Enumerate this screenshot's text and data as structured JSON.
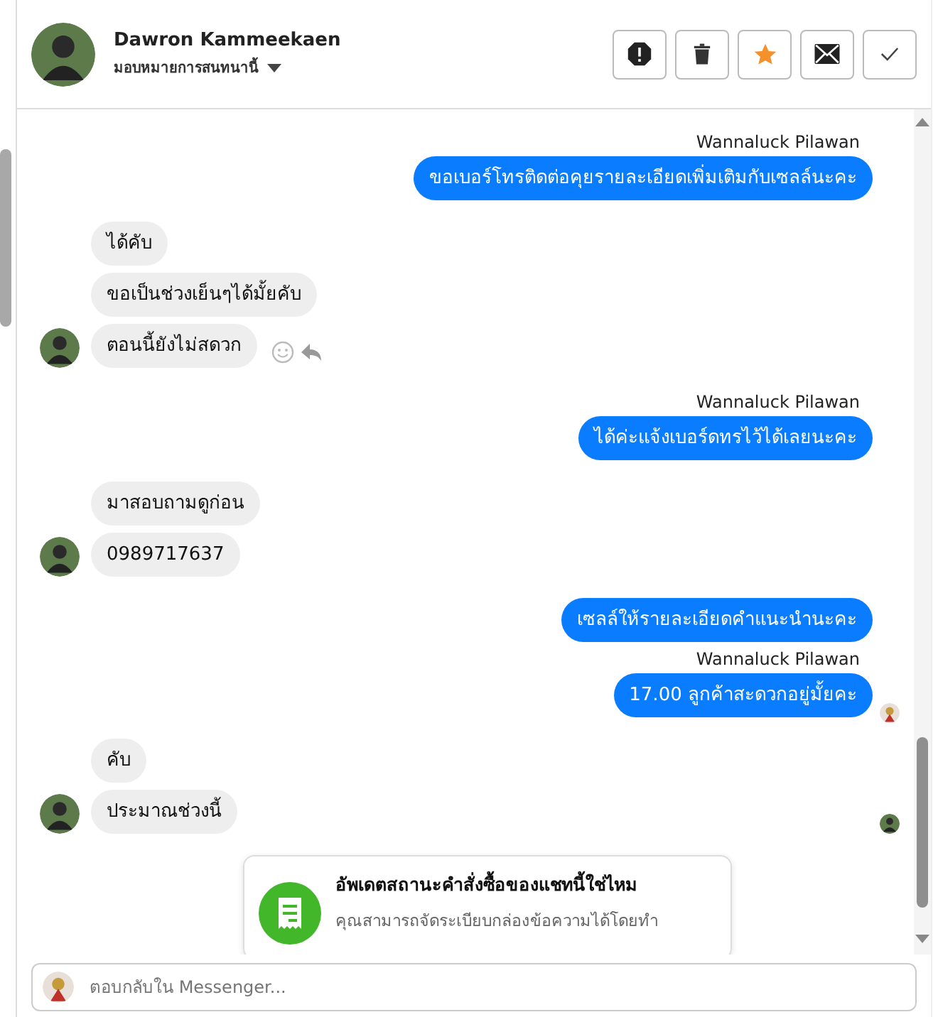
{
  "header": {
    "name": "Dawron Kammeekaen",
    "assign": "มอบหมายการสนทนานี้",
    "actions": [
      {
        "kind": "spam"
      },
      {
        "kind": "delete"
      },
      {
        "kind": "star",
        "on": true
      },
      {
        "kind": "mail"
      },
      {
        "kind": "done"
      }
    ]
  },
  "messages": [
    {
      "kind": "outgoing",
      "sender": "Wannaluck Pilawan",
      "text": "ขอเบอร์โทรติดต่อคุยรายละเอียดเพิ่มเติมกับเซลล์นะคะ"
    },
    {
      "kind": "incoming",
      "text": "ได้คับ",
      "avatar": false
    },
    {
      "kind": "incoming",
      "text": "ขอเป็นช่วงเย็นๆได้มั้ยคับ",
      "avatar": false
    },
    {
      "kind": "incoming",
      "text": "ตอนนี้ยังไม่สดวก",
      "avatar": true,
      "hover_actions": true
    },
    {
      "kind": "outgoing",
      "sender": "Wannaluck Pilawan",
      "text": "ได้ค่ะแจ้งเบอร์ดทรไว้ได้เลยนะคะ"
    },
    {
      "kind": "incoming",
      "text": "มาสอบถามดูก่อน",
      "avatar": false
    },
    {
      "kind": "incoming",
      "text": "0989717637",
      "avatar": true
    },
    {
      "kind": "outgoing",
      "text": "เซลล์ให้รายละเอียดคำแนะนำนะคะ"
    },
    {
      "kind": "outgoing",
      "sender": "Wannaluck Pilawan",
      "text": "17.00 ลูกค้าสะดวกอยู่มั้ยคะ",
      "seen": true
    },
    {
      "kind": "incoming",
      "text": "คับ",
      "avatar": false
    },
    {
      "kind": "incoming",
      "text": "ประมาณช่วงนี้",
      "avatar": true,
      "seen": true
    }
  ],
  "prompt_card": {
    "title": "อัพเดตสถานะคำสั่งซื้อของแชทนี้ใช่ไหม",
    "body": "คุณสามารถจัดระเบียบกล่องข้อความได้โดยทำ"
  },
  "reply": {
    "placeholder": "ตอบกลับใน Messenger..."
  }
}
